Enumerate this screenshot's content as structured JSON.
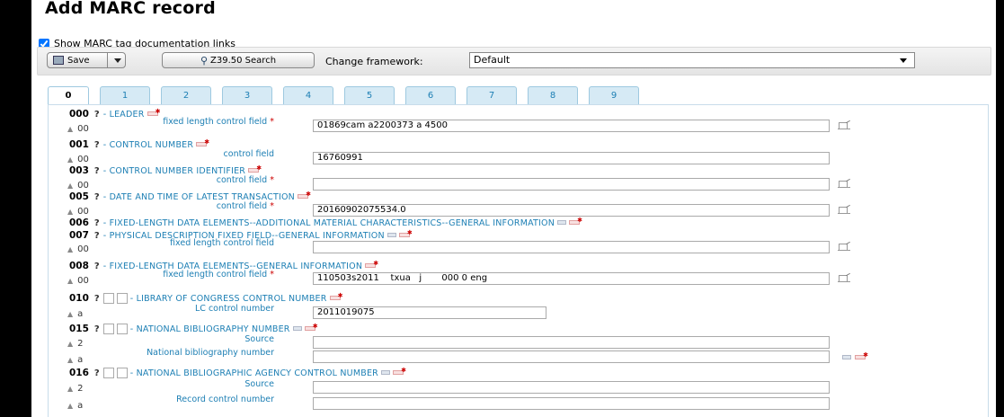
{
  "page_title": "Add MARC record",
  "show_links_label": "Show MARC tag documentation links",
  "toolbar": {
    "save_label": "Save",
    "z3950_label": "Z39.50 Search",
    "change_framework_label": "Change framework:",
    "framework_value": "Default"
  },
  "tabs": [
    "0",
    "1",
    "2",
    "3",
    "4",
    "5",
    "6",
    "7",
    "8",
    "9"
  ],
  "help": "?",
  "fields": {
    "f000": {
      "tag": "000",
      "name": "- LEADER",
      "sub_code": "00",
      "sub_label": "fixed length control field",
      "value": "01869cam a2200373 a 4500"
    },
    "f001": {
      "tag": "001",
      "name": "- CONTROL NUMBER",
      "sub_code": "00",
      "sub_label": "control field",
      "value": "16760991"
    },
    "f003": {
      "tag": "003",
      "name": "- CONTROL NUMBER IDENTIFIER",
      "sub_code": "00",
      "sub_label": "control field",
      "value": ""
    },
    "f005": {
      "tag": "005",
      "name": "- DATE AND TIME OF LATEST TRANSACTION",
      "sub_code": "00",
      "sub_label": "control field",
      "value": "20160902075534.0"
    },
    "f006": {
      "tag": "006",
      "name": "- FIXED-LENGTH DATA ELEMENTS--ADDITIONAL MATERIAL CHARACTERISTICS--GENERAL INFORMATION"
    },
    "f007": {
      "tag": "007",
      "name": "- PHYSICAL DESCRIPTION FIXED FIELD--GENERAL INFORMATION",
      "sub_code": "00",
      "sub_label": "fixed length control field",
      "value": ""
    },
    "f008": {
      "tag": "008",
      "name": "- FIXED-LENGTH DATA ELEMENTS--GENERAL INFORMATION",
      "sub_code": "00",
      "sub_label": "fixed length control field",
      "value": "110503s2011    txua   j       000 0 eng"
    },
    "f010": {
      "tag": "010",
      "name": "- LIBRARY OF CONGRESS CONTROL NUMBER",
      "sub_code": "a",
      "sub_label": "LC control number",
      "value": "2011019075"
    },
    "f015": {
      "tag": "015",
      "name": "- NATIONAL BIBLIOGRAPHY NUMBER",
      "sub2_code": "2",
      "sub2_label": "Source",
      "sub2_value": "",
      "suba_code": "a",
      "suba_label": "National bibliography number",
      "suba_value": ""
    },
    "f016": {
      "tag": "016",
      "name": "- NATIONAL BIBLIOGRAPHIC AGENCY CONTROL NUMBER",
      "sub2_code": "2",
      "sub2_label": "Source",
      "sub2_value": "",
      "suba_code": "a",
      "suba_label": "Record control number",
      "suba_value": ""
    }
  },
  "required_marker": "*"
}
